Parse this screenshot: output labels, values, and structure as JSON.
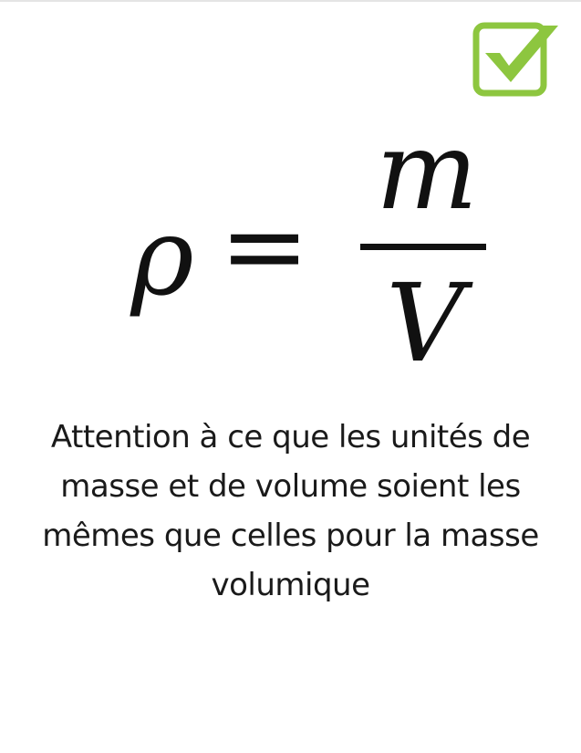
{
  "colors": {
    "check_green": "#8dc63f",
    "text": "#1a1a1a"
  },
  "badge": {
    "icon": "checkbox-checked-icon"
  },
  "formula": {
    "lhs": "ρ",
    "equals": "=",
    "numerator": "m",
    "denominator": "V"
  },
  "note": {
    "text": "Attention à ce que les unités de masse et de volume soient les mêmes que celles pour la masse volumique"
  }
}
